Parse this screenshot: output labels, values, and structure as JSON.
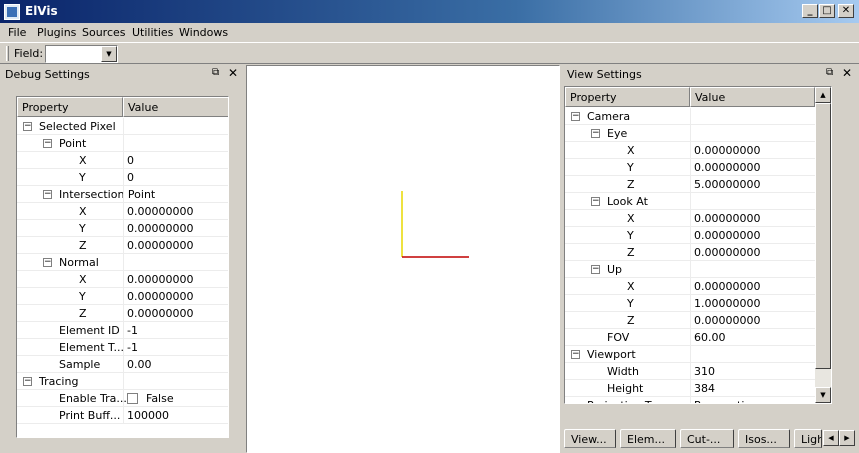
{
  "window": {
    "title": "ElVis",
    "minimize": "_",
    "maximize": "□",
    "close": "✕"
  },
  "menu": [
    "File",
    "Plugins",
    "Sources",
    "Utilities",
    "Windows"
  ],
  "toolbar": {
    "field_label": "Field:",
    "field_value": ""
  },
  "debug_panel": {
    "title": "Debug Settings",
    "col_property": "Property",
    "col_value": "Value",
    "rows": [
      {
        "name": "Selected Pixel",
        "value": "",
        "level": 0,
        "expander": "minus"
      },
      {
        "name": "Point",
        "value": "",
        "level": 1,
        "expander": "minus"
      },
      {
        "name": "X",
        "value": "0",
        "level": 2
      },
      {
        "name": "Y",
        "value": "0",
        "level": 2
      },
      {
        "name": "Intersection Point",
        "value": "",
        "level": 1,
        "expander": "minus"
      },
      {
        "name": "X",
        "value": "0.00000000",
        "level": 2
      },
      {
        "name": "Y",
        "value": "0.00000000",
        "level": 2
      },
      {
        "name": "Z",
        "value": "0.00000000",
        "level": 2
      },
      {
        "name": "Normal",
        "value": "",
        "level": 1,
        "expander": "minus"
      },
      {
        "name": "X",
        "value": "0.00000000",
        "level": 2
      },
      {
        "name": "Y",
        "value": "0.00000000",
        "level": 2
      },
      {
        "name": "Z",
        "value": "0.00000000",
        "level": 2
      },
      {
        "name": "Element ID",
        "value": "-1",
        "level": 1
      },
      {
        "name": "Element T...",
        "value": "-1",
        "level": 1
      },
      {
        "name": "Sample",
        "value": "0.00",
        "level": 1
      },
      {
        "name": "Tracing",
        "value": "",
        "level": 0,
        "expander": "minus"
      },
      {
        "name": "Enable Tra...",
        "value": "False",
        "level": 1,
        "checkbox": true
      },
      {
        "name": "Print Buff...",
        "value": "100000",
        "level": 1
      }
    ]
  },
  "view_panel": {
    "title": "View Settings",
    "col_property": "Property",
    "col_value": "Value",
    "rows": [
      {
        "name": "Camera",
        "value": "",
        "level": 0,
        "expander": "minus"
      },
      {
        "name": "Eye",
        "value": "",
        "level": 1,
        "expander": "minus"
      },
      {
        "name": "X",
        "value": "0.00000000",
        "level": 2
      },
      {
        "name": "Y",
        "value": "0.00000000",
        "level": 2
      },
      {
        "name": "Z",
        "value": "5.00000000",
        "level": 2
      },
      {
        "name": "Look At",
        "value": "",
        "level": 1,
        "expander": "minus"
      },
      {
        "name": "X",
        "value": "0.00000000",
        "level": 2
      },
      {
        "name": "Y",
        "value": "0.00000000",
        "level": 2
      },
      {
        "name": "Z",
        "value": "0.00000000",
        "level": 2
      },
      {
        "name": "Up",
        "value": "",
        "level": 1,
        "expander": "minus"
      },
      {
        "name": "X",
        "value": "0.00000000",
        "level": 2
      },
      {
        "name": "Y",
        "value": "1.00000000",
        "level": 2
      },
      {
        "name": "Z",
        "value": "0.00000000",
        "level": 2
      },
      {
        "name": "FOV",
        "value": "60.00",
        "level": 1
      },
      {
        "name": "Viewport",
        "value": "",
        "level": 0,
        "expander": "minus"
      },
      {
        "name": "Width",
        "value": "310",
        "level": 1
      },
      {
        "name": "Height",
        "value": "384",
        "level": 1
      },
      {
        "name": "Projection Ty...",
        "value": "Perspective",
        "level": 0
      }
    ],
    "tabs": [
      "View...",
      "Elem...",
      "Cut-...",
      "Isos...",
      "Ligh"
    ]
  },
  "colors": {
    "axis_y": "#e8d800",
    "axis_x": "#c00000"
  }
}
